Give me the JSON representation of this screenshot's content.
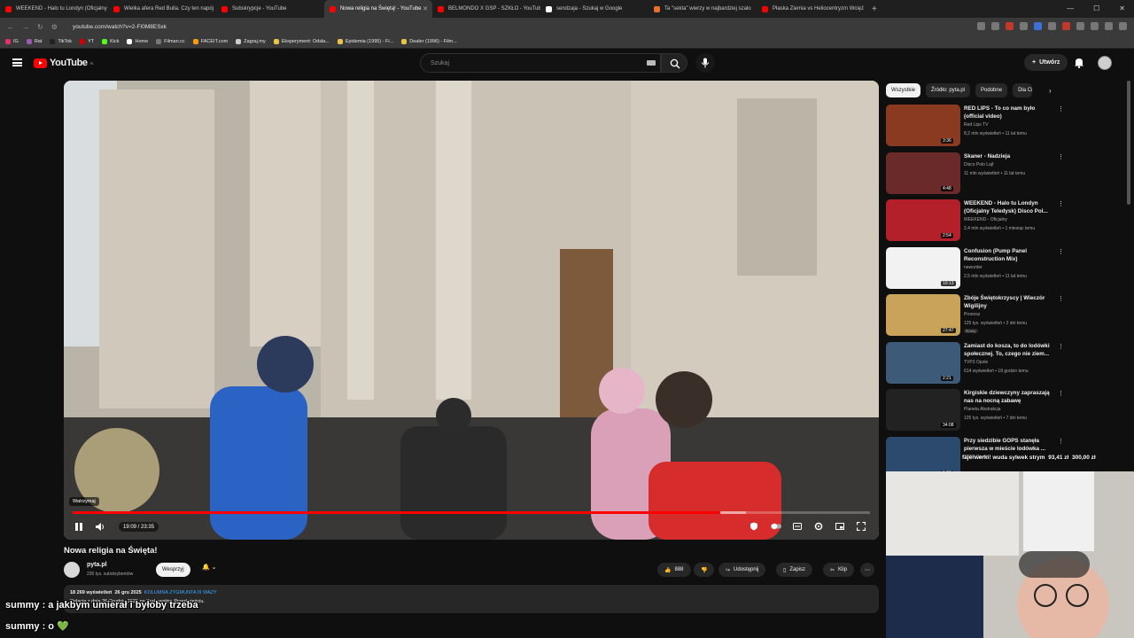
{
  "browser": {
    "tabs": [
      {
        "title": "WEEKEND - Halo tu Londyn (Oficjalny",
        "color": "#ff0000"
      },
      {
        "title": "Wielka afera Red Bulla. Czy ten napój",
        "color": "#ff0000"
      },
      {
        "title": "Subskrypcje - YouTube",
        "color": "#ff0000"
      },
      {
        "title": "Nowa religia na Świętą! - YouTube",
        "color": "#ff0000",
        "active": true
      },
      {
        "title": "BELMONDO X GSP - SZKŁO - YouTube",
        "color": "#ff0000"
      },
      {
        "title": "sendzaja - Szukaj w Google",
        "color": "#ffffff"
      },
      {
        "title": "Ta \"sekta\" wierzy w najbardziej szalo",
        "color": "#e8712a"
      },
      {
        "title": "Płaska Ziemia vs Heliocentryzm Wcięż",
        "color": "#ff0000"
      }
    ],
    "url": "youtube.com/watch?v=2-FI0M8ESxk",
    "bookmarks": [
      "IG",
      "Rat",
      "TikTok",
      "YT",
      "Kick",
      "Home",
      "Filman.cc",
      "FACEIT.com",
      "Zagraj.my",
      "Eksperyment: Odsła...",
      "Epidemia (1995) - Fi...",
      "Dealer (1996) - Film..."
    ]
  },
  "youtube": {
    "logo_text": "YouTube",
    "logo_region": "PL",
    "search_placeholder": "Szukaj",
    "create_label": "Utwórz"
  },
  "player": {
    "watch_later": "Watrzymaj",
    "time": "19:09 / 23:35",
    "progress_played": 0.812,
    "progress_loaded": 0.845
  },
  "video": {
    "title": "Nowa religia na Święta!",
    "channel": "pyta.pl",
    "subscribers": "235 tys. subskrybentów",
    "support_label": "Wesprzyj",
    "likes": "888",
    "share_label": "Udostępnij",
    "save_label": "Zapisz",
    "clip_label": "Klip",
    "views": "18 269 wyświetleń",
    "date": "26 gru 2025",
    "tag": "KOLUMNA ZYGMUNTA III WAZY",
    "description": "Relacja z dnia 26 Grudnia 2025 na Krakowskim Przedmieściu."
  },
  "chat": [
    {
      "text": "summy : a jakbym umierał i byłoby trzeba"
    },
    {
      "text": "summy : o 💚"
    }
  ],
  "chips": [
    "Wszystkie",
    "Źródło: pyta.pl",
    "Podobne",
    "Dla Ciebie"
  ],
  "recommendations": [
    {
      "title": "RED LIPS - To co nam było (official video)",
      "channel": "Red Lips TV",
      "meta": "8,2 mln wyświetleń • 11 lat temu",
      "duration": "3:36",
      "thumb": "#8a3a20",
      "lines": 2
    },
    {
      "title": "Skaner - Nadzieja",
      "channel": "Disco Polo Lajf",
      "meta": "11 mln wyświetleń • 11 lat temu",
      "duration": "4:48",
      "thumb": "#6b2a2a",
      "lines": 1
    },
    {
      "title": "WEEKEND - Halo tu Londyn (Oficjalny Teledysk) Disco Pol...",
      "channel": "WEEKEND - Oficjalny",
      "meta": "2,4 mln wyświetleń • 1 miesiąc temu",
      "duration": "2:54",
      "thumb": "#b3202a",
      "lines": 2
    },
    {
      "title": "Confusion (Pump Panel Reconstruction Mix)",
      "channel": "neworder",
      "meta": "2,5 mln wyświetleń • 11 lat temu",
      "duration": "10:13",
      "thumb": "#f2f2f2",
      "lines": 2
    },
    {
      "title": "Zbóje Świętokrzyscy | Wieczór Wigilijny",
      "channel": "Pronosz",
      "meta": "125 tys. wyświetleń • 2 dni temu",
      "duration": "27:47",
      "thumb": "#c9a35a",
      "lines": 2,
      "new": "Nowy"
    },
    {
      "title": "Zamiast do kosza, to do lodówki społecznej. To, czego nie ziem...",
      "channel": "TVP3 Opole",
      "meta": "614 wyświetleń • 18 godzin temu",
      "duration": "2:21",
      "thumb": "#3d5a78",
      "lines": 2
    },
    {
      "title": "Kirgiskie dziewczyny zapraszają nas na nocną zabawę",
      "channel": "Planeta Abstrakcja",
      "meta": "125 tys. wyświetleń • 7 dni temu",
      "duration": "34:08",
      "thumb": "#222222",
      "lines": 2
    },
    {
      "title": "Przy siedzibie GOPS stanęła pierwsza w mieście lodówka ...",
      "channel": "TVP3 Opole",
      "meta": "",
      "duration": "1:36",
      "thumb": "#2c4a6e",
      "lines": 2,
      "new": "Nowy"
    }
  ],
  "donation": {
    "text": "fajerwerki! wuda sylwek strym",
    "amount1": "93,41 zł",
    "amount2": "300,00 zł"
  }
}
